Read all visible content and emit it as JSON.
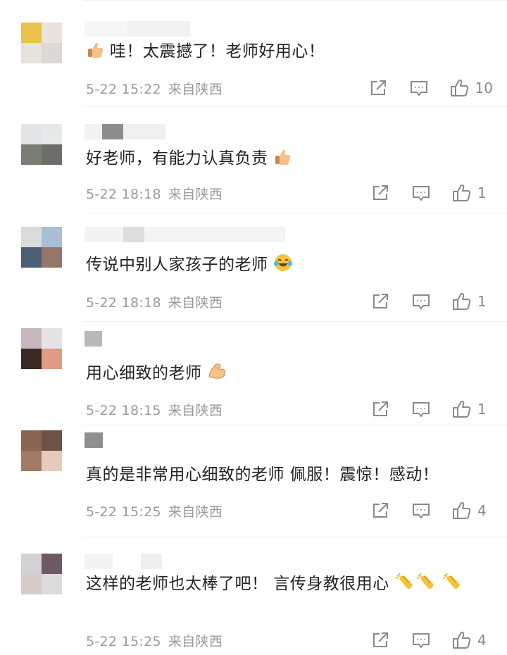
{
  "comments": [
    {
      "text": "哇！太震撼了！老师好用心！",
      "lead_emoji": "thumbs-up-emoji",
      "date": "5-22 15:22",
      "location": "来自陕西",
      "likes": "10",
      "avatar_colors": [
        "#e8c24a",
        "#e9e3d9",
        "#e6e2dc",
        "#dcd8d3"
      ]
    },
    {
      "text": "好老师，有能力认真负责",
      "trail_emoji": "thumbs-up-emoji",
      "date": "5-22 18:18",
      "location": "来自陕西",
      "likes": "1",
      "avatar_colors": [
        "#e3e5e7",
        "#e6e8ea",
        "#7a7c76",
        "#6c6e68"
      ]
    },
    {
      "text": "传说中别人家孩子的老师",
      "trail_emoji": "laugh-cry-emoji",
      "date": "5-22 18:18",
      "location": "来自陕西",
      "likes": "1",
      "avatar_colors": [
        "#d9dbdd",
        "#a8bfd4",
        "#4c5f77",
        "#94766b"
      ]
    },
    {
      "text": "用心细致的老师",
      "trail_emoji": "flexed-biceps-emoji",
      "date": "5-22 18:15",
      "location": "来自陕西",
      "likes": "1",
      "avatar_colors": [
        "#c7b6bd",
        "#e6e2e6",
        "#3a2a26",
        "#e09b84"
      ]
    },
    {
      "text": "真的是非常用心细致的老师 佩服！震惊！感动！",
      "date": "5-22 15:25",
      "location": "来自陕西",
      "likes": "4",
      "avatar_colors": [
        "#8c6552",
        "#6c5345",
        "#a27a64",
        "#e6cabc"
      ]
    },
    {
      "text": "这样的老师也太棒了吧！ 言传身教很用心",
      "trail_emoji": "clapping-hands-emoji",
      "date": "5-22 15:25",
      "location": "来自陕西",
      "likes": "4",
      "avatar_colors": [
        "#d3d1d4",
        "#6e5a64",
        "#d8cdc6",
        "#dedbdf"
      ]
    }
  ],
  "colors": {
    "text": "#222222",
    "meta": "#9a9a9a",
    "icon": "#8a8a8a",
    "emoji_yellow": "#f5c33b",
    "emoji_skin": "#f2c28a"
  }
}
